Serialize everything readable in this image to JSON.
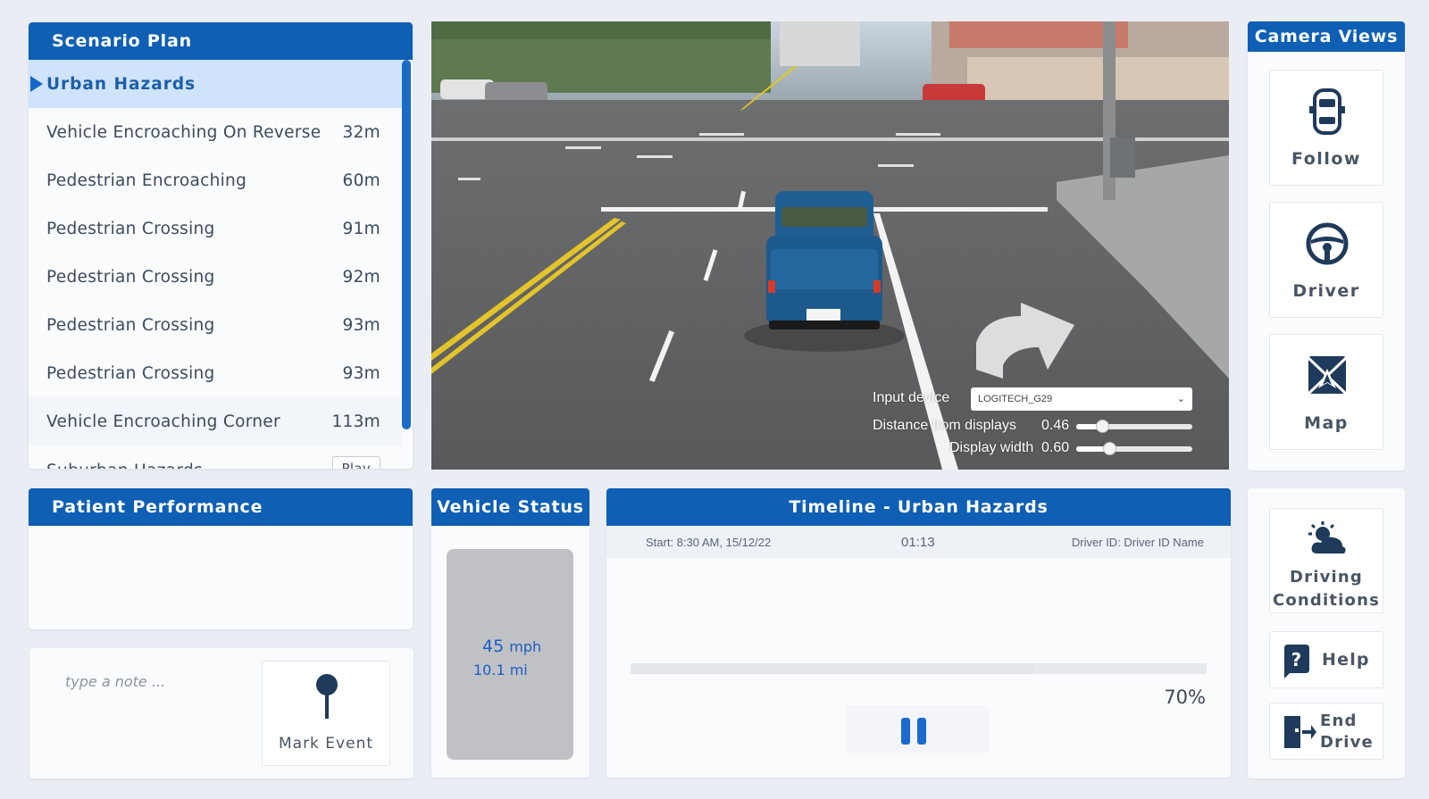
{
  "scenario_plan": {
    "title": "Scenario Plan",
    "active_item": "Urban Hazards",
    "items": [
      {
        "label": "Vehicle Encroaching On Reverse",
        "distance": "32m"
      },
      {
        "label": "Pedestrian Encroaching",
        "distance": "60m"
      },
      {
        "label": "Pedestrian Crossing",
        "distance": "91m"
      },
      {
        "label": "Pedestrian Crossing",
        "distance": "92m"
      },
      {
        "label": "Pedestrian Crossing",
        "distance": "93m"
      },
      {
        "label": "Pedestrian Crossing",
        "distance": "93m"
      },
      {
        "label": "Vehicle Encroaching Corner",
        "distance": "113m"
      }
    ],
    "partial_item": "Suburban Hazards",
    "partial_button": "Play"
  },
  "scene_controls": {
    "input_device_label": "Input device",
    "input_device_value": "LOGITECH_G29",
    "distance_label": "Distance from displays",
    "distance_value": "0.46",
    "distance_fraction": 0.46,
    "width_label": "Display width",
    "width_value": "0.60",
    "width_fraction": 0.6
  },
  "camera_views": {
    "title": "Camera Views",
    "follow": "Follow",
    "driver": "Driver",
    "map": "Map"
  },
  "patient_performance": {
    "title": "Patient Performance"
  },
  "notes": {
    "placeholder": "type a note ...",
    "mark_event": "Mark Event"
  },
  "vehicle_status": {
    "title": "Vehicle Status",
    "speed": "45",
    "speed_unit": "mph",
    "distance": "10.1",
    "distance_unit": "mi"
  },
  "timeline": {
    "title": "Timeline - Urban Hazards",
    "start": "Start: 8:30 AM, 15/12/22",
    "clock": "01:13",
    "driver_id": "Driver ID: Driver ID Name",
    "progress_percent": 70,
    "progress_label": "70%"
  },
  "actions": {
    "driving_conditions_line1": "Driving",
    "driving_conditions_line2": "Conditions",
    "help": "Help",
    "end_drive_line1": "End",
    "end_drive_line2": "Drive"
  },
  "colors": {
    "header_blue": "#0f5fb5",
    "accent_blue": "#1668c8",
    "active_row_bg": "#cfe3fb",
    "truck_blue": "#1f5e92"
  }
}
